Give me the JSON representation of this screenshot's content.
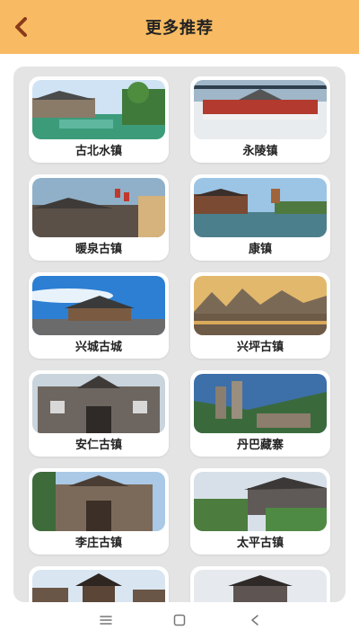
{
  "header": {
    "title": "更多推荐",
    "back_icon": "chevron-left-icon"
  },
  "colors": {
    "header_bg": "#f8bb63",
    "panel_bg": "#e4e4e4",
    "accent": "#8b3a1a"
  },
  "places": [
    {
      "name": "古北水镇",
      "image": "water-town-photo"
    },
    {
      "name": "永陵镇",
      "image": "snowy-temple-photo"
    },
    {
      "name": "暖泉古镇",
      "image": "old-street-lanterns-photo"
    },
    {
      "name": "康镇",
      "image": "lake-town-photo"
    },
    {
      "name": "兴城古城",
      "image": "city-gate-blue-sky-photo"
    },
    {
      "name": "兴坪古镇",
      "image": "karst-river-photo"
    },
    {
      "name": "安仁古镇",
      "image": "mansion-facade-photo"
    },
    {
      "name": "丹巴藏寨",
      "image": "stone-towers-photo"
    },
    {
      "name": "李庄古镇",
      "image": "memorial-gate-photo"
    },
    {
      "name": "太平古镇",
      "image": "hillside-houses-photo"
    },
    {
      "name": "",
      "image": "tower-pavilion-photo"
    },
    {
      "name": "",
      "image": "gate-tower-photo"
    }
  ],
  "navbar": {
    "menu_icon": "menu-icon",
    "home_icon": "home-square-icon",
    "back_icon": "back-triangle-icon"
  }
}
